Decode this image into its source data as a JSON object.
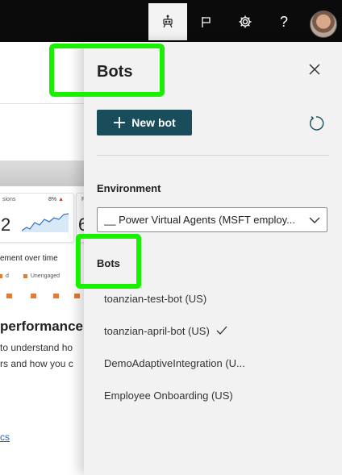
{
  "topbar": {
    "icons": [
      "bot-icon",
      "flag-icon",
      "gear-icon",
      "help-icon"
    ],
    "help_label": "?"
  },
  "background": {
    "sessions_label": "sions",
    "sessions_pct": "8%",
    "sessions_value": "2",
    "card2_label": "R",
    "card2_value": "6",
    "engagement_heading": "ement over time",
    "legend_engaged": "d",
    "legend_unengaged": "Unengaged",
    "performance_heading": "performance",
    "text_line1": "to understand ho",
    "text_line2": "rs and how you c",
    "link": "cs"
  },
  "panel": {
    "title": "Bots",
    "new_bot_label": "New bot",
    "environment_label": "Environment",
    "environment_value": "__ Power Virtual Agents (MSFT employ...",
    "bots_label": "Bots",
    "bots": [
      {
        "name": "toanzian-test-bot (US)",
        "selected": false
      },
      {
        "name": "toanzian-april-bot (US)",
        "selected": true
      },
      {
        "name": "DemoAdaptiveIntegration (U...",
        "selected": false
      },
      {
        "name": "Employee Onboarding (US)",
        "selected": false
      }
    ]
  },
  "colors": {
    "accent": "#1a4d5c",
    "highlight": "#18f000",
    "topbar": "#0b0b0b",
    "panel_bg": "#f2f2f2"
  }
}
